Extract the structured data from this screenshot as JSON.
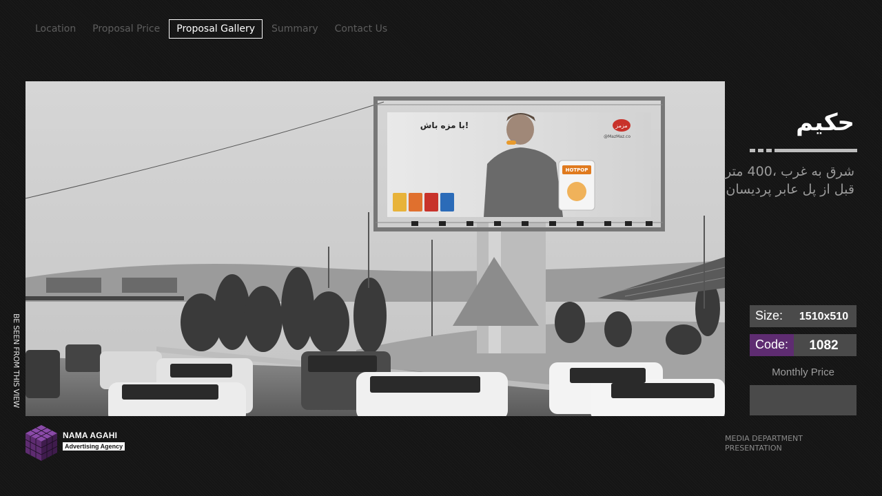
{
  "nav": {
    "items": [
      {
        "label": "Location"
      },
      {
        "label": "Proposal Price"
      },
      {
        "label": "Proposal Gallery"
      },
      {
        "label": "Summary"
      },
      {
        "label": "Contact Us"
      }
    ],
    "active_index": 2
  },
  "gallery": {
    "side_caption": "BE SEEN FROM THIS VIEW",
    "billboard_text": "با مزه باش!",
    "billboard_handle": "@MazMaz.co",
    "billboard_brand": "مزمز",
    "product_label": "HOTPOP"
  },
  "info": {
    "title": "حکیم",
    "address": "شرق به غرب ،400 متر قبل از پل عابر پردیسان",
    "size_label": "Size:",
    "size_value": "1510x510",
    "code_label": "Code:",
    "code_value": "1082",
    "price_label": "Monthly Price",
    "price_value": ""
  },
  "footer": {
    "logo_name": "NAMA AGAHI",
    "logo_tagline": "Advertising Agency",
    "dept_line1": "MEDIA DEPARTMENT",
    "dept_line2": "PRESENTATION"
  },
  "colors": {
    "accent_purple": "#5e2c71",
    "panel_gray": "#4a4a4a",
    "active_nav": "#ffffff",
    "inactive_nav": "#5d5d5d"
  }
}
